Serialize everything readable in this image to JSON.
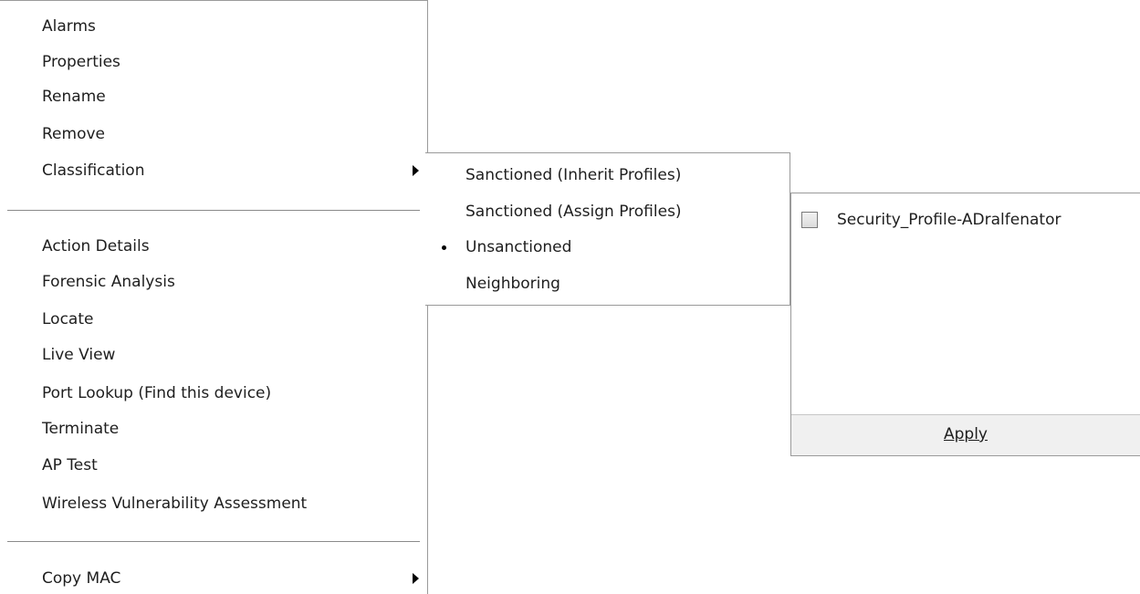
{
  "main_menu": {
    "group1": [
      "Alarms",
      "Properties",
      "Rename",
      "Remove",
      "Classification"
    ],
    "group2": [
      "Action Details",
      "Forensic Analysis",
      "Locate",
      "Live View",
      "Port Lookup (Find this device)",
      "Terminate",
      "AP Test",
      "Wireless Vulnerability Assessment"
    ],
    "group3": [
      "Copy MAC"
    ]
  },
  "classification_menu": {
    "items": [
      "Sanctioned (Inherit Profiles)",
      "Sanctioned (Assign Profiles)",
      "Unsanctioned",
      "Neighboring"
    ],
    "selected": "Unsanctioned"
  },
  "profiles_panel": {
    "profiles": [
      {
        "label": "Security_Profile-ADralfenator",
        "checked": false
      }
    ],
    "apply_label": "Apply"
  },
  "icons": {
    "submenu_arrow": "caret-right-icon",
    "selected_marker": "bullet-icon",
    "checkbox": "checkbox-icon"
  }
}
